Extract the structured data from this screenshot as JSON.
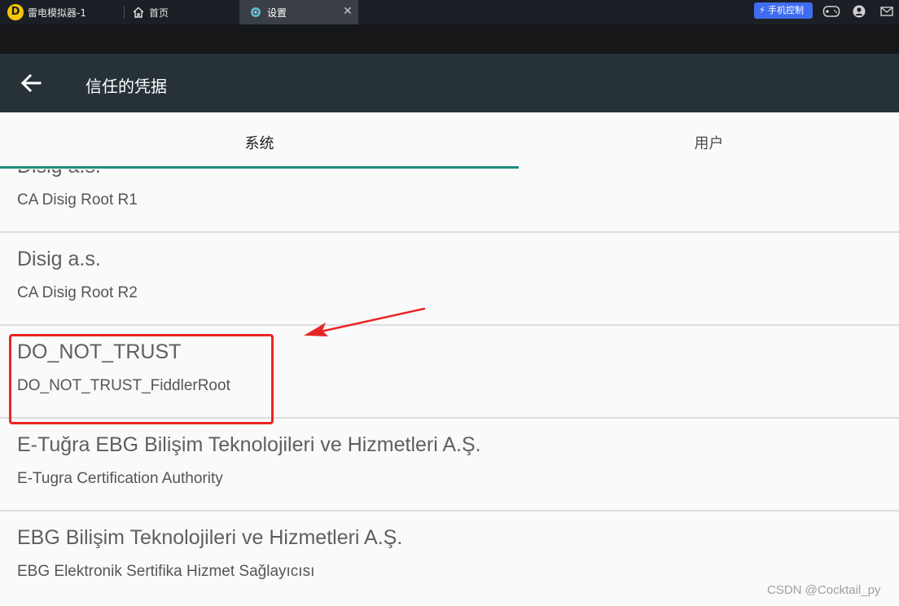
{
  "emulator": {
    "app_title": "雷电模拟器-1",
    "tabs": [
      {
        "label": "首页",
        "icon": "home-icon"
      },
      {
        "label": "设置",
        "icon": "settings-gear-icon"
      }
    ],
    "phone_control_label": "手机控制",
    "colors": {
      "bar": "#1b1e24",
      "active_tab": "#3a3e47",
      "phone_control": "#3f6cf0"
    }
  },
  "toolbar": {
    "title": "信任的凭据",
    "back_icon": "back-arrow-icon",
    "color": "#263238"
  },
  "tabs": {
    "system": "系统",
    "user": "用户",
    "active": "system",
    "indicator_color": "#1e8c7e"
  },
  "certificates": [
    {
      "organization": "Disig a.s.",
      "name": "CA Disig Root R1"
    },
    {
      "organization": "Disig a.s.",
      "name": "CA Disig Root R2"
    },
    {
      "organization": "DO_NOT_TRUST",
      "name": "DO_NOT_TRUST_FiddlerRoot"
    },
    {
      "organization": "E-Tuğra EBG Bilişim Teknolojileri ve Hizmetleri A.Ş.",
      "name": "E-Tugra Certification Authority"
    },
    {
      "organization": "EBG Bilişim Teknolojileri ve Hizmetleri A.Ş.",
      "name": "EBG Elektronik Sertifika Hizmet Sağlayıcısı"
    }
  ],
  "annotation": {
    "color": "#ea2525",
    "highlighted_item": "DO_NOT_TRUST"
  },
  "watermark": "CSDN @Cocktail_py"
}
